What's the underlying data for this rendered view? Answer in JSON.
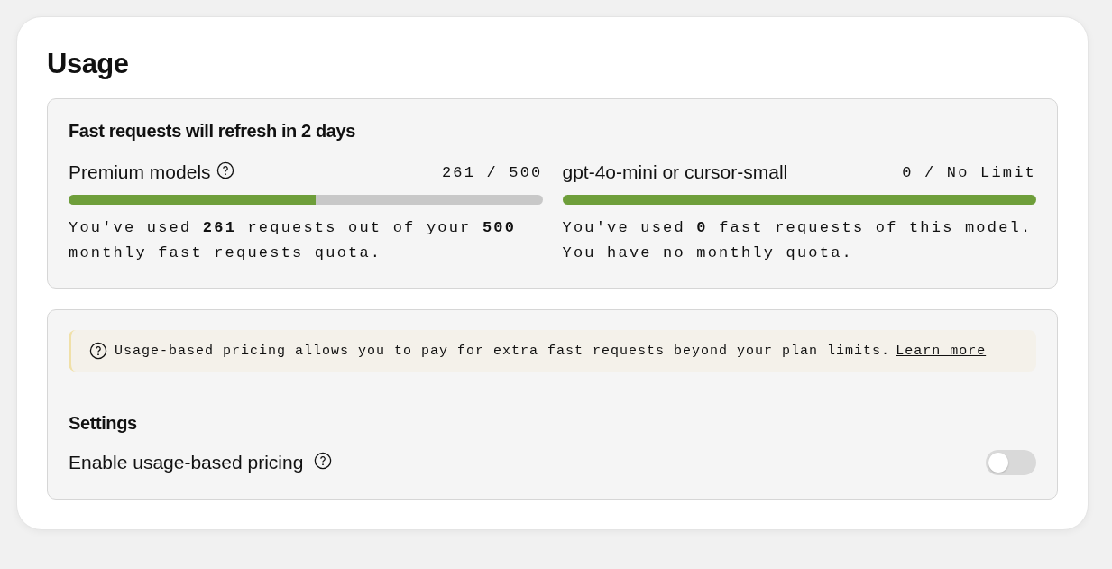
{
  "title": "Usage",
  "usage_panel": {
    "heading": "Fast requests will refresh in 2 days",
    "meters": [
      {
        "name": "Premium models",
        "has_help": true,
        "count": "261 / 500",
        "level": 0.522,
        "description": "You've used **261** requests out of your **500** monthly fast requests quota."
      },
      {
        "name": "gpt-4o-mini or cursor-small",
        "has_help": false,
        "count": "0 / No Limit",
        "level": 1,
        "description": "You've used **0** fast requests of this model. You have no monthly quota."
      }
    ]
  },
  "pricing_panel": {
    "notice": {
      "text": "Usage-based pricing allows you to pay for extra fast requests beyond your plan limits.",
      "link": "Learn more"
    },
    "settings_heading": "Settings",
    "settings": [
      {
        "label": "Enable usage-based pricing",
        "has_help": true,
        "on": false
      }
    ]
  }
}
